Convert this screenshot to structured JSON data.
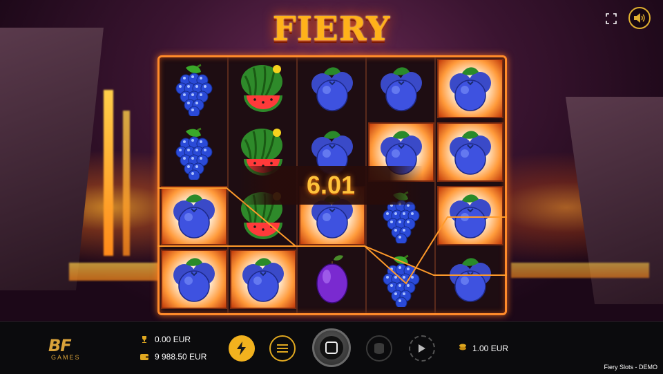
{
  "game": {
    "title": "FIERY SLOTS",
    "footer_title": "Fiery Slots - DEMO"
  },
  "top_controls": {
    "fullscreen_icon": "fullscreen-icon",
    "sound_icon": "speaker-icon"
  },
  "reels": {
    "columns": [
      [
        "grapes",
        "grapes",
        "blueberry-fire",
        "blueberry-fire"
      ],
      [
        "watermelon",
        "watermelon",
        "watermelon",
        "blueberry-fire"
      ],
      [
        "blueberry",
        "blueberry",
        "blueberry-fire",
        "plum"
      ],
      [
        "blueberry",
        "blueberry-fire",
        "grapes",
        "grapes"
      ],
      [
        "blueberry-fire",
        "blueberry-fire",
        "blueberry-fire",
        "blueberry"
      ]
    ]
  },
  "win_banner": {
    "value": "6.01"
  },
  "bottom_bar": {
    "win": "0.00 EUR",
    "balance": "9 988.50 EUR",
    "bet": "1.00 EUR",
    "logo_main": "BF",
    "logo_sub": "GAMES",
    "icons": {
      "win": "trophy-icon",
      "balance": "wallet-icon",
      "turbo": "lightning-icon",
      "menu": "hamburger-icon",
      "spin": "spin-icon",
      "stake": "coin-stack-icon",
      "autoplay": "play-icon",
      "bet": "coin-icon"
    }
  },
  "colors": {
    "accent": "#f2b21e",
    "frame": "#ff8a2a",
    "title": "#ffb21a",
    "win_text": "#ffc23a"
  }
}
